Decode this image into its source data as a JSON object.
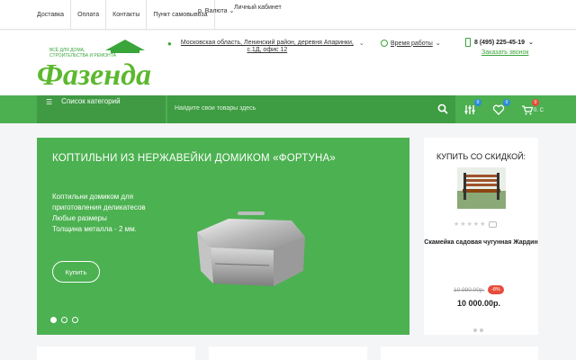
{
  "topbar": {
    "nav": [
      "Доставка",
      "Оплата",
      "Контакты",
      "Пункт самовывоза"
    ],
    "currency": "р. Валюта",
    "cabinet": "Личный кабинет"
  },
  "header": {
    "logo_text": "Фазенда",
    "logo_tagline_1": "ВСЁ ДЛЯ ДОМА,",
    "logo_tagline_2": "СТРОИТЕЛЬСТВА И РЕМОНТА",
    "address": "Московская область, Ленинский район, деревня Апаринки, с.1Д, офис 12",
    "hours_label": "Время работы",
    "phone": "8 (495) 225-45-19",
    "callback": "Заказать звонок"
  },
  "navbar": {
    "categories": "Список категорий",
    "search_placeholder": "Найдите свои товары здесь",
    "compare_count": "0",
    "wishlist_count": "0",
    "cart_count": "0",
    "cart_price": "0. С"
  },
  "slider": {
    "title": "КОПТИЛЬНИ ИЗ НЕРЖАВЕЙКИ ДОМИКОМ «ФОРТУНА»",
    "desc_1": "Коптильни домиком для приготовления деликатесов",
    "desc_2": "Любые размеры",
    "desc_3": "Толщина металла - 2 мм.",
    "button": "Купить"
  },
  "discount": {
    "title": "КУПИТЬ СО СКИДКОЙ:",
    "product_name": "Скамейка садовая чугунная Жардин",
    "old_price": "10 990.00р.",
    "discount": "-8%",
    "price": "10 000.00р.",
    "rating": 0
  },
  "colors": {
    "brand_green": "#4caf50",
    "sale_red": "#e74c3c",
    "badge_blue": "#2b8cd8"
  }
}
